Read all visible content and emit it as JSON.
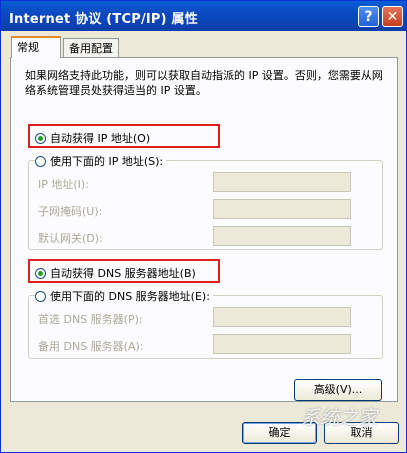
{
  "window": {
    "title": "Internet 协议 (TCP/IP) 属性"
  },
  "titlebar": {
    "help": "?",
    "close": "✕"
  },
  "tabs": [
    {
      "label": "常规"
    },
    {
      "label": "备用配置"
    }
  ],
  "description": "如果网络支持此功能，则可以获取自动指派的 IP 设置。否则，您需要从网络系统管理员处获得适当的 IP 设置。",
  "ip": {
    "auto_label": "自动获得 IP 地址(O)",
    "manual_label": "使用下面的 IP 地址(S):",
    "selected": "auto",
    "fields": [
      {
        "label": "IP 地址(I):",
        "value": ""
      },
      {
        "label": "子网掩码(U):",
        "value": ""
      },
      {
        "label": "默认网关(D):",
        "value": ""
      }
    ]
  },
  "dns": {
    "auto_label": "自动获得 DNS 服务器地址(B)",
    "manual_label": "使用下面的 DNS 服务器地址(E):",
    "selected": "auto",
    "fields": [
      {
        "label": "首选 DNS 服务器(P):",
        "value": ""
      },
      {
        "label": "备用 DNS 服务器(A):",
        "value": ""
      }
    ]
  },
  "buttons": {
    "advanced": "高级(V)...",
    "ok": "确定",
    "cancel": "取消"
  },
  "watermark": "系统之家"
}
